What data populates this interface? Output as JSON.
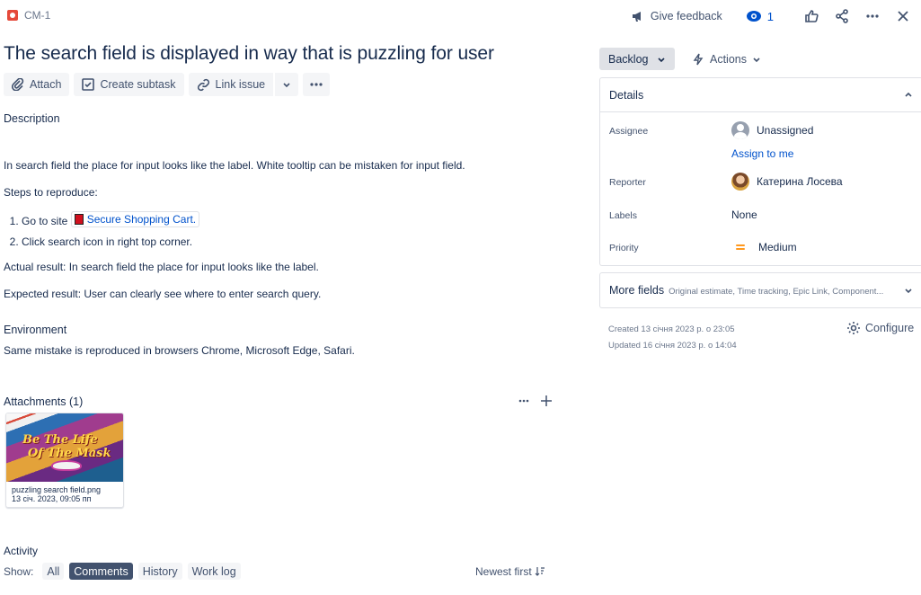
{
  "issue": {
    "key": "CM-1",
    "title": "The search field is displayed in way that is puzzling for user"
  },
  "header": {
    "feedback_label": "Give feedback",
    "watchers_count": "1"
  },
  "toolbar": {
    "attach_label": "Attach",
    "create_subtask_label": "Create subtask",
    "link_issue_label": "Link issue"
  },
  "description": {
    "heading": "Description",
    "intro": "In search field the place for input looks like the label.  White tooltip can be mistaken for input field.",
    "steps_heading": "Steps to reproduce:",
    "step1_prefix": "Go to site",
    "step1_link": "Secure Shopping Cart.",
    "step2": "Click search icon in right top corner.",
    "actual": "Actual result: In search field the place for input looks like the label.",
    "expected": "Expected result: User can clearly see where to enter search query."
  },
  "environment": {
    "heading": "Environment",
    "text": "Same mistake is reproduced in browsers Chrome, Microsoft Edge, Safari."
  },
  "attachments": {
    "heading": "Attachments (1)",
    "items": [
      {
        "thumb_text_line1": "Be The Life",
        "thumb_text_line2": "Of The Mask",
        "filename": "puzzling search field.png",
        "date": "13 січ. 2023, 09:05 пп"
      }
    ]
  },
  "activity": {
    "heading": "Activity",
    "show_label": "Show:",
    "filters": [
      "All",
      "Comments",
      "History",
      "Work log"
    ],
    "active_filter": "Comments",
    "sort_label": "Newest first"
  },
  "sidebar": {
    "status": "Backlog",
    "actions_label": "Actions",
    "details_heading": "Details",
    "fields": {
      "assignee_label": "Assignee",
      "assignee_value": "Unassigned",
      "assign_to_me": "Assign to me",
      "reporter_label": "Reporter",
      "reporter_value": "Катерина Лосева",
      "labels_label": "Labels",
      "labels_value": "None",
      "priority_label": "Priority",
      "priority_value": "Medium"
    },
    "more_fields_label": "More fields",
    "more_fields_hint": "Original estimate, Time tracking, Epic Link, Component...",
    "created": "Created 13 січня 2023 р. о 23:05",
    "updated": "Updated 16 січня 2023 р. о 14:04",
    "configure_label": "Configure"
  },
  "colors": {
    "link": "#0052cc",
    "priority_medium": "#ff991f",
    "bug": "#e5493a",
    "active_filter_bg": "#42526e"
  }
}
